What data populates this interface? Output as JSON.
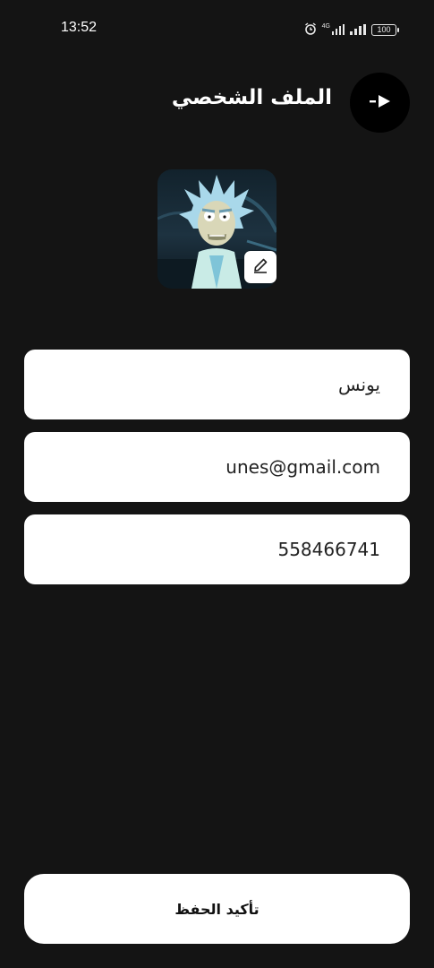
{
  "status_bar": {
    "time": "13:52",
    "network_label": "4G",
    "battery": "100"
  },
  "header": {
    "title": "الملف الشخصي",
    "back_icon": "logout-arrow-icon"
  },
  "avatar": {
    "image": "cartoon-character-avatar",
    "edit_icon": "pencil-icon"
  },
  "form": {
    "name_value": "يونس",
    "email_value": "unes@gmail.com",
    "phone_value": "558466741"
  },
  "actions": {
    "confirm_label": "تأكيد الحفظ"
  },
  "colors": {
    "background": "#141414",
    "surface": "#ffffff",
    "back_button_bg": "#000000"
  }
}
